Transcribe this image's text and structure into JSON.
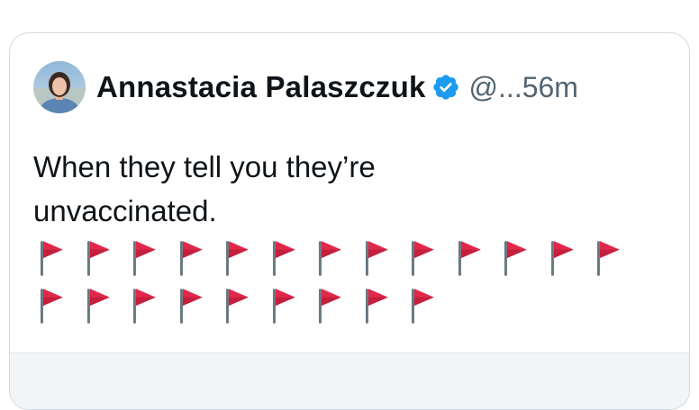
{
  "author": {
    "display_name": "Annastacia Palaszczuk",
    "verified_icon": "verified-badge-icon",
    "handle_time": "@...56m"
  },
  "tweet": {
    "line1": "When they tell you they’re",
    "line2": "unvaccinated.",
    "emoji": "triangular-flag-icon",
    "flag_row_counts": [
      13,
      9
    ]
  },
  "colors": {
    "verified_blue": "#1d9bf0",
    "flag_red": "#e0284a",
    "text": "#0f1419",
    "muted": "#536471"
  }
}
